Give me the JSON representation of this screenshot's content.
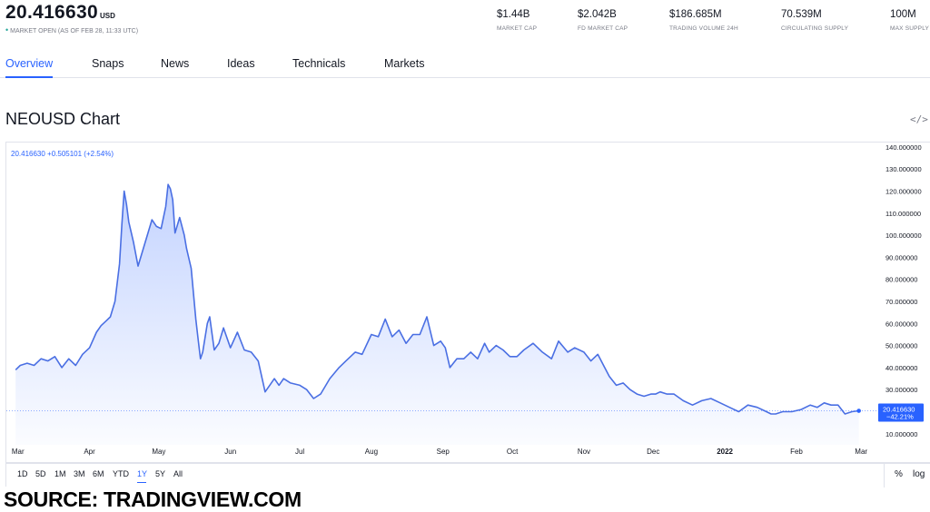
{
  "header": {
    "price": "20.416630",
    "currency": "USD",
    "market_status_dot": "•",
    "market_status": "MARKET OPEN (AS OF FEB 28, 11:33 UTC)",
    "stats": [
      {
        "value": "$1.44B",
        "label": "MARKET CAP"
      },
      {
        "value": "$2.042B",
        "label": "FD MARKET CAP"
      },
      {
        "value": "$186.685M",
        "label": "TRADING VOLUME 24H"
      },
      {
        "value": "70.539M",
        "label": "CIRCULATING SUPPLY"
      },
      {
        "value": "100M",
        "label": "MAX SUPPLY"
      }
    ]
  },
  "tabs": [
    "Overview",
    "Snaps",
    "News",
    "Ideas",
    "Technicals",
    "Markets"
  ],
  "active_tab": "Overview",
  "chart_title": "NEOUSD Chart",
  "embed_icon": "code-embed-icon",
  "legend": "20.416630 +0.505101 (+2.54%)",
  "price_badge": {
    "price": "20.416630",
    "change": "−42.21%"
  },
  "ranges": [
    "1D",
    "5D",
    "1M",
    "3M",
    "6M",
    "YTD",
    "1Y",
    "5Y",
    "All"
  ],
  "active_range": "1Y",
  "scale_buttons": [
    "%",
    "log"
  ],
  "source": "SOURCE: TRADINGVIEW.COM",
  "colors": {
    "accent": "#2962ff",
    "line": "#4a6fe3",
    "grid": "#e0e3eb",
    "positive": "#26a69a"
  },
  "chart_data": {
    "type": "area",
    "title": "NEOUSD Chart",
    "ylim": [
      5,
      142
    ],
    "y_ticks": [
      "140.000000",
      "130.000000",
      "120.000000",
      "110.000000",
      "100.000000",
      "90.000000",
      "80.000000",
      "70.000000",
      "60.000000",
      "50.000000",
      "40.000000",
      "30.000000",
      "10.000000"
    ],
    "x_ticks": [
      {
        "label": "Mar",
        "x": "2021-03-01"
      },
      {
        "label": "Apr",
        "x": "2021-04-01"
      },
      {
        "label": "May",
        "x": "2021-05-01"
      },
      {
        "label": "Jun",
        "x": "2021-06-01"
      },
      {
        "label": "Jul",
        "x": "2021-07-01"
      },
      {
        "label": "Aug",
        "x": "2021-08-01"
      },
      {
        "label": "Sep",
        "x": "2021-09-01"
      },
      {
        "label": "Oct",
        "x": "2021-10-01"
      },
      {
        "label": "Nov",
        "x": "2021-11-01"
      },
      {
        "label": "Dec",
        "x": "2021-12-01"
      },
      {
        "label": "2022",
        "x": "2022-01-01"
      },
      {
        "label": "Feb",
        "x": "2022-02-01"
      },
      {
        "label": "Mar",
        "x": "2022-03-01"
      }
    ],
    "last_value": 20.41663,
    "series": [
      {
        "x": [
          "2021-02-28",
          "2021-03-02",
          "2021-03-05",
          "2021-03-08",
          "2021-03-11",
          "2021-03-14",
          "2021-03-17",
          "2021-03-20",
          "2021-03-23",
          "2021-03-26",
          "2021-03-29",
          "2021-04-01",
          "2021-04-04",
          "2021-04-06",
          "2021-04-08",
          "2021-04-10",
          "2021-04-12",
          "2021-04-14",
          "2021-04-15",
          "2021-04-16",
          "2021-04-17",
          "2021-04-18",
          "2021-04-20",
          "2021-04-22",
          "2021-04-24",
          "2021-04-26",
          "2021-04-28",
          "2021-04-30",
          "2021-05-02",
          "2021-05-04",
          "2021-05-05",
          "2021-05-06",
          "2021-05-07",
          "2021-05-08",
          "2021-05-10",
          "2021-05-12",
          "2021-05-13",
          "2021-05-15",
          "2021-05-17",
          "2021-05-18",
          "2021-05-19",
          "2021-05-20",
          "2021-05-22",
          "2021-05-23",
          "2021-05-25",
          "2021-05-27",
          "2021-05-29",
          "2021-06-01",
          "2021-06-04",
          "2021-06-07",
          "2021-06-10",
          "2021-06-13",
          "2021-06-16",
          "2021-06-18",
          "2021-06-20",
          "2021-06-22",
          "2021-06-24",
          "2021-06-27",
          "2021-07-01",
          "2021-07-04",
          "2021-07-07",
          "2021-07-10",
          "2021-07-14",
          "2021-07-18",
          "2021-07-21",
          "2021-07-25",
          "2021-07-28",
          "2021-08-01",
          "2021-08-04",
          "2021-08-07",
          "2021-08-10",
          "2021-08-13",
          "2021-08-16",
          "2021-08-19",
          "2021-08-22",
          "2021-08-25",
          "2021-08-28",
          "2021-08-31",
          "2021-09-02",
          "2021-09-04",
          "2021-09-07",
          "2021-09-10",
          "2021-09-13",
          "2021-09-16",
          "2021-09-19",
          "2021-09-21",
          "2021-09-24",
          "2021-09-27",
          "2021-09-30",
          "2021-10-03",
          "2021-10-06",
          "2021-10-10",
          "2021-10-14",
          "2021-10-18",
          "2021-10-21",
          "2021-10-25",
          "2021-10-28",
          "2021-11-01",
          "2021-11-04",
          "2021-11-07",
          "2021-11-10",
          "2021-11-12",
          "2021-11-15",
          "2021-11-18",
          "2021-11-21",
          "2021-11-24",
          "2021-11-27",
          "2021-11-30",
          "2021-12-02",
          "2021-12-04",
          "2021-12-07",
          "2021-12-10",
          "2021-12-14",
          "2021-12-18",
          "2021-12-22",
          "2021-12-26",
          "2021-12-30",
          "2022-01-03",
          "2022-01-07",
          "2022-01-11",
          "2022-01-15",
          "2022-01-19",
          "2022-01-21",
          "2022-01-23",
          "2022-01-26",
          "2022-01-30",
          "2022-02-03",
          "2022-02-07",
          "2022-02-10",
          "2022-02-13",
          "2022-02-16",
          "2022-02-19",
          "2022-02-22",
          "2022-02-25",
          "2022-02-28"
        ],
        "values": [
          39,
          41,
          42,
          41,
          44,
          43,
          45,
          40,
          44,
          41,
          46,
          49,
          56,
          59,
          61,
          63,
          70,
          87,
          105,
          120,
          114,
          106,
          97,
          86,
          93,
          100,
          107,
          104,
          103,
          113,
          123,
          121,
          116,
          101,
          108,
          100,
          94,
          85,
          62,
          53,
          44,
          47,
          60,
          63,
          48,
          51,
          58,
          49,
          56,
          48,
          47,
          43,
          29,
          32,
          35,
          32,
          35,
          33,
          32,
          30,
          26,
          28,
          35,
          40,
          43,
          47,
          46,
          55,
          54,
          62,
          54,
          57,
          51,
          55,
          55,
          63,
          50,
          52,
          49,
          40,
          44,
          44,
          47,
          44,
          51,
          47,
          50,
          48,
          45,
          45,
          48,
          51,
          47,
          44,
          52,
          47,
          49,
          47,
          43,
          46,
          40,
          36,
          32,
          33,
          30,
          28,
          27,
          28,
          28,
          29,
          28,
          28,
          25,
          23,
          25,
          26,
          24,
          22,
          20,
          23,
          22,
          20,
          19,
          19,
          20,
          20,
          21,
          23,
          22,
          24,
          23,
          23,
          19,
          20,
          20.42
        ]
      }
    ]
  }
}
